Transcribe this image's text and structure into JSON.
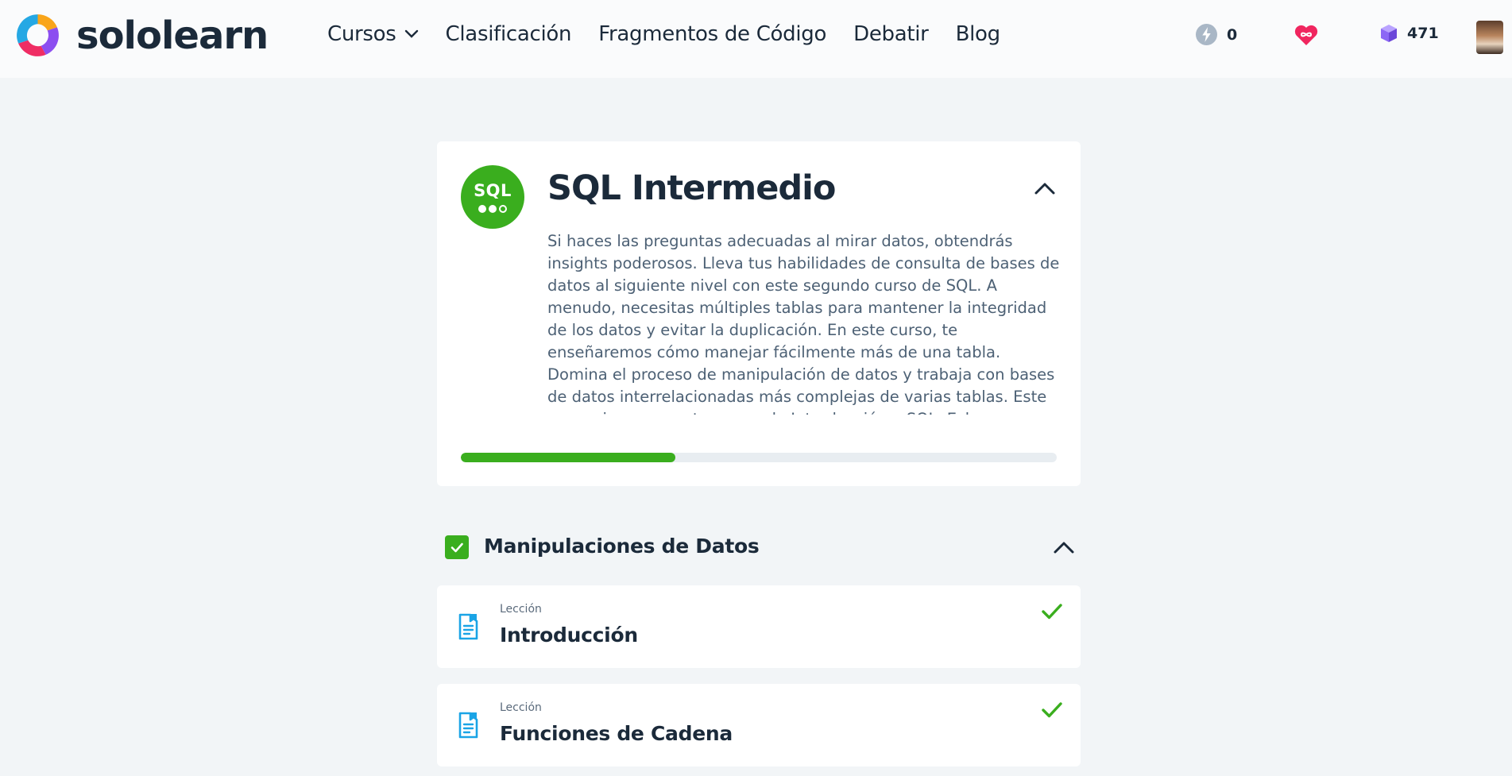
{
  "header": {
    "brand": "sololearn",
    "nav": {
      "courses": "Cursos",
      "leaderboard": "Clasificación",
      "code_playground": "Fragmentos de Código",
      "discuss": "Debatir",
      "blog": "Blog"
    },
    "streak_count": "0",
    "gems_count": "471"
  },
  "course": {
    "badge_label": "SQL",
    "title": "SQL Intermedio",
    "description": "Si haces las preguntas adecuadas al mirar datos, obtendrás insights poderosos. Lleva tus habilidades de consulta de bases de datos al siguiente nivel con este segundo curso de SQL. A menudo, necesitas múltiples tablas para mantener la integridad de los datos y evitar la duplicación. En este curso, te enseñaremos cómo manejar fácilmente más de una tabla. Domina el proceso de manipulación de datos y trabaja con bases de datos interrelacionadas más complejas de varias tablas. Este curso sigue a nuestro curso de Introducción a SQL. Echa un vistazo rápido a lo que cubre y, si te sientes cómodo con esos",
    "progress": 0.36
  },
  "module": {
    "title": "Manipulaciones de Datos",
    "lessons": [
      {
        "kind": "Lección",
        "title": "Introducción"
      },
      {
        "kind": "Lección",
        "title": "Funciones de Cadena"
      }
    ]
  },
  "colors": {
    "accent_green": "#3aae1e",
    "lesson_icon_blue": "#1aa4e6",
    "heart_pink": "#f0265f",
    "gem_purple": "#8c67f5"
  }
}
